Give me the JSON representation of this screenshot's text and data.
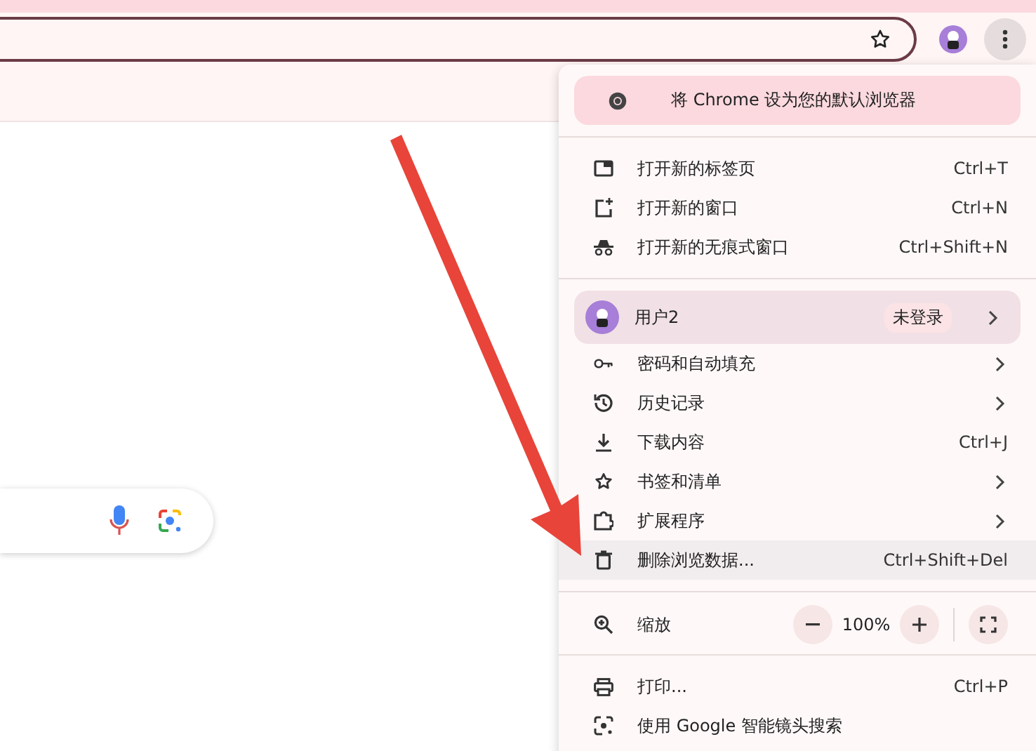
{
  "menu": {
    "sections": [
      [
        {
          "kind": "banner",
          "label": "将 Chrome 设为您的默认浏览器"
        }
      ],
      [
        {
          "kind": "item",
          "label": "打开新的标签页",
          "shortcut": "Ctrl+T",
          "submenu": false,
          "highlighted": false
        },
        {
          "kind": "item",
          "label": "打开新的窗口",
          "shortcut": "Ctrl+N",
          "submenu": false,
          "highlighted": false
        },
        {
          "kind": "item",
          "label": "打开新的无痕式窗口",
          "shortcut": "Ctrl+Shift+N",
          "submenu": false,
          "highlighted": false
        }
      ],
      [
        {
          "kind": "profile",
          "label": "用户2",
          "badge": "未登录",
          "submenu": true
        },
        {
          "kind": "item",
          "label": "密码和自动填充",
          "submenu": true,
          "highlighted": false
        },
        {
          "kind": "item",
          "label": "历史记录",
          "submenu": true,
          "highlighted": false
        },
        {
          "kind": "item",
          "label": "下载内容",
          "shortcut": "Ctrl+J",
          "submenu": false,
          "highlighted": false
        },
        {
          "kind": "item",
          "label": "书签和清单",
          "submenu": true,
          "highlighted": false
        },
        {
          "kind": "item",
          "label": "扩展程序",
          "submenu": true,
          "highlighted": false
        },
        {
          "kind": "item",
          "label": "删除浏览数据...",
          "shortcut": "Ctrl+Shift+Del",
          "submenu": false,
          "highlighted": true
        }
      ],
      [
        {
          "kind": "zoom",
          "label": "缩放",
          "value": "100%"
        }
      ],
      [
        {
          "kind": "item",
          "label": "打印...",
          "shortcut": "Ctrl+P",
          "submenu": false,
          "highlighted": false
        },
        {
          "kind": "item",
          "label": "使用 Google 智能镜头搜索",
          "submenu": false,
          "highlighted": false
        }
      ]
    ]
  }
}
